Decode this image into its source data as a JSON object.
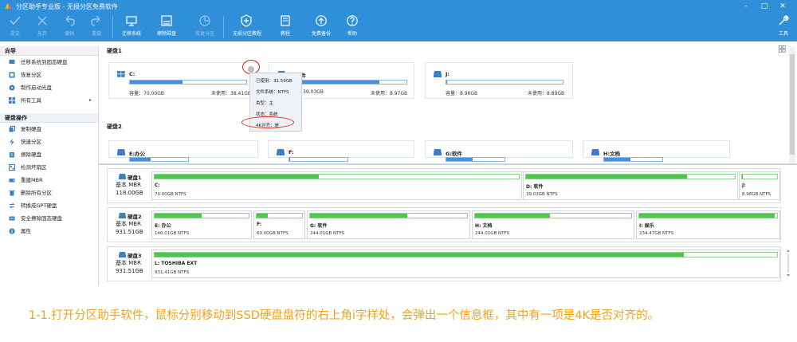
{
  "window": {
    "title": "分区助手专业版 - 无损分区免费软件",
    "controls": [
      "–",
      "□",
      "✕"
    ]
  },
  "toolbar": {
    "items": [
      {
        "label": "提交",
        "icon": "check-icon",
        "enabled": false
      },
      {
        "label": "放弃",
        "icon": "discard-icon",
        "enabled": false
      },
      {
        "label": "撤销",
        "icon": "undo-icon",
        "enabled": false
      },
      {
        "label": "重做",
        "icon": "redo-icon",
        "enabled": false
      },
      {
        "label": "迁移系统",
        "icon": "migrate-os-icon",
        "enabled": true
      },
      {
        "label": "擦除磁盘",
        "icon": "wipe-disk-icon",
        "enabled": true
      },
      {
        "label": "恢复分区",
        "icon": "partition-recovery-icon",
        "enabled": false
      },
      {
        "label": "无损分区教程",
        "icon": "shield-icon",
        "enabled": true
      },
      {
        "label": "教程",
        "icon": "book-icon",
        "enabled": true
      },
      {
        "label": "免费备份",
        "icon": "backup-icon",
        "enabled": true
      },
      {
        "label": "帮助",
        "icon": "help-icon",
        "enabled": true
      }
    ],
    "tools_label": "工具"
  },
  "sidebar": {
    "wizard_title": "向导",
    "wizard_items": [
      {
        "label": "迁移系统到固态硬盘",
        "icon": "migrate-icon",
        "has_arrow": false
      },
      {
        "label": "恢复分区",
        "icon": "recover-icon",
        "has_arrow": false
      },
      {
        "label": "制作启动光盘",
        "icon": "bootable-media-icon",
        "has_arrow": false
      },
      {
        "label": "所有工具",
        "icon": "all-tools-icon",
        "has_arrow": true
      }
    ],
    "disk_ops_title": "硬盘操作",
    "disk_ops_items": [
      {
        "label": "复制硬盘",
        "icon": "copy-disk-icon"
      },
      {
        "label": "快速分区",
        "icon": "quick-partition-icon"
      },
      {
        "label": "擦除硬盘",
        "icon": "wipe-icon"
      },
      {
        "label": "检测坏扇区",
        "icon": "bad-sector-icon"
      },
      {
        "label": "重建MBR",
        "icon": "rebuild-mbr-icon"
      },
      {
        "label": "删除所有分区",
        "icon": "delete-partitions-icon"
      },
      {
        "label": "转换成GPT硬盘",
        "icon": "convert-gpt-icon"
      },
      {
        "label": "安全擦除固态硬盘",
        "icon": "ssd-erase-icon"
      },
      {
        "label": "属性",
        "icon": "properties-icon"
      }
    ],
    "arrow": "▸"
  },
  "volumes": {
    "disk1_label": "硬盘1",
    "disk2_label": "硬盘2",
    "disk1_cards": [
      {
        "name": "C:",
        "capacity_label": "容量：",
        "capacity": "70.00GB",
        "free_label": "未使用：",
        "free": "38.41GB",
        "used_fraction": 0.45
      },
      {
        "name": "D:软件",
        "capacity": "39.03GB",
        "free_label": "未使用：",
        "free": "8.97GB",
        "used_fraction": 0.77
      },
      {
        "name": "J:",
        "capacity_label": "容量：",
        "capacity": "8.96GB",
        "free_label": "未使用：",
        "free": "8.89GB",
        "used_fraction": 0.01
      }
    ],
    "disk2_cards": [
      {
        "name": "E:办公",
        "used_fraction": 0.35
      },
      {
        "name": "F:",
        "used_fraction": 0.02
      },
      {
        "name": "G:软件",
        "used_fraction": 0.45
      },
      {
        "name": "H:文档",
        "used_fraction": 0.45
      }
    ]
  },
  "popup": {
    "used": "已使用：31.59GB",
    "fs": "文件系统：NTFS",
    "type": "类型：主",
    "status": "状态：系统",
    "aligned": "4K对齐：是"
  },
  "disk_maps": [
    {
      "name": "硬盘1",
      "type": "基本 MBR",
      "size": "118.00GB",
      "partitions": [
        {
          "name": "C:",
          "size": "70.00GB NTFS",
          "used_fraction": 0.45
        },
        {
          "name": "D: 软件",
          "size": "39.03GB NTFS",
          "used_fraction": 0.77
        },
        {
          "name": "J:",
          "size": "8.96GB NTFS",
          "used_fraction": 0.01
        }
      ]
    },
    {
      "name": "硬盘2",
      "type": "基本 MBR",
      "size": "931.51GB",
      "partitions": [
        {
          "name": "E: 办公",
          "size": "140.01GB NTFS",
          "used_fraction": 0.5
        },
        {
          "name": "F:",
          "size": "60.00GB NTFS",
          "used_fraction": 0.25
        },
        {
          "name": "G: 软件",
          "size": "244.01GB NTFS",
          "used_fraction": 0.62
        },
        {
          "name": "H: 文档",
          "size": "244.01GB NTFS",
          "used_fraction": 0.48
        },
        {
          "name": "I: 娱乐",
          "size": "234.47GB NTFS",
          "used_fraction": 0.98
        }
      ]
    },
    {
      "name": "硬盘3",
      "type": "基本 MBR",
      "size": "931.51GB",
      "partitions": [
        {
          "name": "L: TOSHIBA EXT",
          "size": "931.41GB NTFS",
          "used_fraction": 0.85
        }
      ]
    }
  ],
  "caption": "1-1.打开分区助手软件，鼠标分别移动到SSD硬盘盘符的右上角i字样处，会弹出一个信息框，其中有一项是4K是否对齐的。",
  "colors": {
    "toolbar_bg": "#2f8fd8",
    "volume_bar": "#4a90d9",
    "partition_bar": "#4cc74c",
    "highlight_ring": "#e02020",
    "caption": "#f0a31a"
  }
}
